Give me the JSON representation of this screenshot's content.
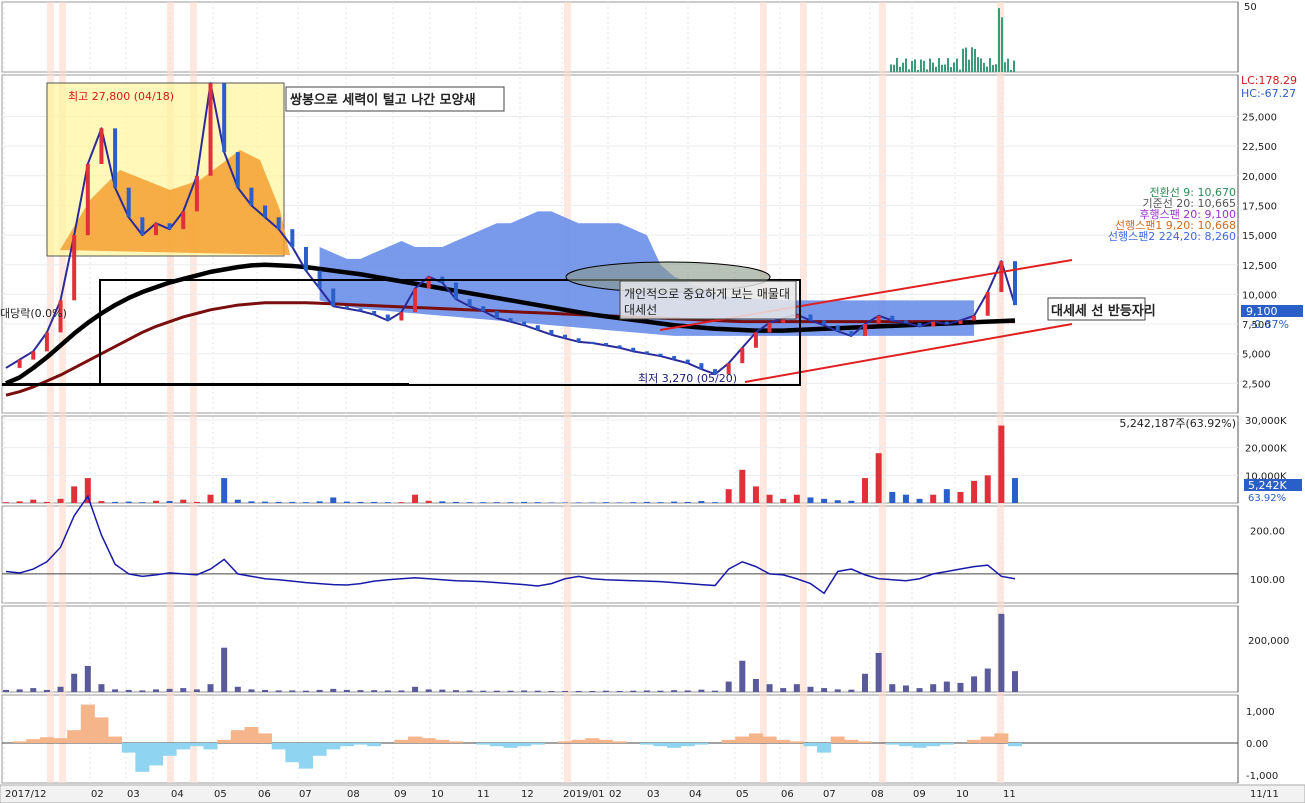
{
  "chart_data": {
    "type": "line",
    "title": "",
    "x_month_labels": [
      "2017/12",
      "02",
      "03",
      "04",
      "05",
      "06",
      "07",
      "08",
      "09",
      "10",
      "11",
      "12",
      "2019/01",
      "02",
      "03",
      "04",
      "05",
      "06",
      "07",
      "08",
      "09",
      "10",
      "11"
    ],
    "x_end_label": "11/11",
    "price_axis_ticks": [
      "25,000",
      "22,500",
      "20,000",
      "17,500",
      "15,000",
      "12,500",
      "10,000",
      "7,500",
      "5,000",
      "2,500"
    ],
    "price_ylim": [
      0,
      28500
    ],
    "price_close": [
      3800,
      4500,
      5200,
      6800,
      9500,
      15000,
      21000,
      24000,
      19000,
      16500,
      15000,
      16000,
      15500,
      17000,
      20000,
      27800,
      22000,
      19000,
      17500,
      16500,
      15500,
      14000,
      12000,
      10500,
      9000,
      8800,
      8600,
      8300,
      7800,
      8500,
      10500,
      11500,
      11000,
      9600,
      9000,
      8600,
      8000,
      7700,
      7400,
      7000,
      6600,
      6300,
      6000,
      5900,
      5700,
      5500,
      5200,
      5000,
      4800,
      4500,
      4200,
      3700,
      3270,
      4200,
      5500,
      6800,
      7600,
      8000,
      8300,
      7800,
      7400,
      6900,
      6500,
      7500,
      8200,
      7800,
      7600,
      7300,
      7700,
      7500,
      7800,
      8200,
      10200,
      12800,
      9100
    ],
    "ma_long": [
      2500,
      3000,
      3800,
      4700,
      5700,
      6700,
      7600,
      8400,
      9100,
      9700,
      10200,
      10600,
      11000,
      11300,
      11600,
      11900,
      12100,
      12300,
      12450,
      12500,
      12450,
      12400,
      12300,
      12150,
      12000,
      11850,
      11700,
      11500,
      11300,
      11100,
      10900,
      10700,
      10500,
      10300,
      10100,
      9900,
      9700,
      9500,
      9300,
      9100,
      8900,
      8700,
      8500,
      8300,
      8150,
      8000,
      7850,
      7700,
      7550,
      7400,
      7300,
      7200,
      7100,
      7050,
      7000,
      6950,
      6950,
      6950,
      7000,
      7050,
      7100,
      7150,
      7200,
      7250,
      7300,
      7350,
      7400,
      7450,
      7500,
      7550,
      7600,
      7650,
      7700,
      7750,
      7800
    ],
    "ma_200": [
      1500,
      1800,
      2200,
      2700,
      3200,
      3800,
      4400,
      5000,
      5600,
      6200,
      6800,
      7300,
      7700,
      8100,
      8400,
      8700,
      8900,
      9100,
      9200,
      9300,
      9300,
      9300,
      9300,
      9250,
      9200,
      9150,
      9100,
      9050,
      9000,
      8950,
      8900,
      8850,
      8800,
      8750,
      8700,
      8650,
      8600,
      8550,
      8500,
      8450,
      8400,
      8350,
      8300,
      8250,
      8200,
      8150,
      8100,
      8050,
      8000,
      7950,
      7900,
      7850,
      7800,
      7750,
      7700,
      7700,
      7700,
      7700,
      7700,
      7700,
      7700,
      7700,
      7700,
      7700,
      7700,
      7700,
      7700,
      7700,
      7700,
      7700,
      7700,
      7700,
      7700,
      7700,
      7700
    ],
    "cloud_top": [
      0,
      0,
      0,
      0,
      0,
      0,
      0,
      0,
      0,
      0,
      0,
      0,
      0,
      0,
      0,
      0,
      0,
      0,
      0,
      0,
      0,
      0,
      0,
      14000,
      13500,
      13000,
      13000,
      13500,
      14000,
      14500,
      14000,
      14000,
      14000,
      14500,
      15000,
      15500,
      16000,
      16000,
      16500,
      17000,
      17000,
      16500,
      16000,
      16000,
      16000,
      16000,
      15500,
      15000,
      12500,
      11500,
      11000,
      10500,
      10000,
      9800,
      9700,
      9600,
      9600,
      9500,
      9500,
      9500,
      9500,
      9500,
      9500,
      9500,
      9500,
      9500,
      9500,
      9500,
      9500,
      9500,
      9500,
      9500,
      0,
      0,
      0
    ],
    "cloud_bottom": [
      0,
      0,
      0,
      0,
      0,
      0,
      0,
      0,
      0,
      0,
      0,
      0,
      0,
      0,
      0,
      0,
      0,
      0,
      0,
      0,
      0,
      0,
      0,
      9500,
      9200,
      9000,
      8800,
      8700,
      8600,
      8500,
      8400,
      8300,
      8200,
      8100,
      8000,
      7900,
      7800,
      7700,
      7600,
      7500,
      7400,
      7300,
      7200,
      7100,
      7000,
      6900,
      6800,
      6700,
      6600,
      6500,
      6500,
      6500,
      6500,
      6500,
      6500,
      6500,
      6500,
      6500,
      6500,
      6500,
      6500,
      6500,
      6500,
      6500,
      6500,
      6500,
      6500,
      6500,
      6500,
      6500,
      6500,
      6500,
      0,
      0,
      0
    ],
    "volume_axis_ticks": [
      "30,000K",
      "20,000K",
      "10,000K"
    ],
    "volume_ylim": [
      0,
      30000
    ],
    "volume": [
      300,
      600,
      1200,
      400,
      1500,
      6000,
      9000,
      700,
      400,
      500,
      300,
      800,
      700,
      1200,
      400,
      3000,
      9000,
      1200,
      600,
      500,
      400,
      400,
      300,
      600,
      2000,
      500,
      400,
      400,
      300,
      300,
      3000,
      800,
      600,
      400,
      300,
      300,
      300,
      300,
      400,
      300,
      200,
      200,
      200,
      200,
      300,
      200,
      300,
      400,
      300,
      500,
      400,
      700,
      300,
      5000,
      12000,
      6000,
      3000,
      1500,
      3000,
      2000,
      1500,
      1000,
      800,
      9000,
      18000,
      4000,
      3000,
      1500,
      3000,
      5000,
      4000,
      8000,
      10000,
      28000,
      9000
    ],
    "volume_last_label": "5,242K",
    "volume_last_pct": "63.92%",
    "volume_header": "5,242,187주(63.92%)",
    "ind1_axis_ticks": [
      "200.00",
      "100.00"
    ],
    "ind1_ylim": [
      50,
      250
    ],
    "ind1": [
      115,
      112,
      120,
      135,
      165,
      230,
      270,
      190,
      130,
      110,
      105,
      108,
      112,
      110,
      108,
      120,
      140,
      110,
      105,
      100,
      98,
      95,
      92,
      90,
      88,
      87,
      90,
      95,
      98,
      100,
      102,
      100,
      98,
      96,
      95,
      94,
      92,
      90,
      88,
      85,
      90,
      100,
      105,
      100,
      98,
      97,
      96,
      95,
      94,
      92,
      90,
      88,
      86,
      120,
      135,
      125,
      110,
      108,
      100,
      90,
      70,
      115,
      120,
      108,
      100,
      98,
      96,
      100,
      110,
      115,
      120,
      125,
      128,
      105,
      100
    ],
    "ind1_baseline": 110,
    "ind2_axis_ticks": [
      "200,000"
    ],
    "ind2_ylim": [
      0,
      330000
    ],
    "ind2": [
      8000,
      10000,
      15000,
      8000,
      20000,
      70000,
      100000,
      30000,
      10000,
      8000,
      6000,
      10000,
      12000,
      15000,
      10000,
      30000,
      170000,
      20000,
      10000,
      8000,
      6000,
      6000,
      5000,
      8000,
      12000,
      8000,
      7000,
      7000,
      6000,
      6000,
      20000,
      10000,
      9000,
      7000,
      6000,
      5000,
      5000,
      5000,
      6000,
      5000,
      4000,
      4000,
      4000,
      4000,
      5000,
      4000,
      5000,
      6000,
      5000,
      7000,
      6000,
      9000,
      5000,
      40000,
      120000,
      50000,
      30000,
      15000,
      30000,
      20000,
      15000,
      10000,
      9000,
      70000,
      150000,
      30000,
      25000,
      15000,
      30000,
      40000,
      35000,
      60000,
      90000,
      300000,
      80000
    ],
    "ind3_axis_ticks": [
      "1,000",
      "0.00",
      "-1,000"
    ],
    "ind3_ylim": [
      -1250,
      1500
    ],
    "ind3": [
      0,
      50,
      120,
      180,
      150,
      400,
      1200,
      800,
      200,
      -300,
      -900,
      -700,
      -400,
      -200,
      -100,
      -200,
      100,
      400,
      500,
      300,
      -200,
      -600,
      -800,
      -400,
      -200,
      -100,
      -50,
      -100,
      0,
      100,
      200,
      150,
      100,
      50,
      0,
      -50,
      -100,
      -150,
      -100,
      -50,
      0,
      50,
      100,
      150,
      100,
      50,
      0,
      -50,
      -100,
      -150,
      -100,
      -50,
      0,
      100,
      200,
      300,
      200,
      100,
      50,
      -100,
      -300,
      200,
      100,
      50,
      0,
      -50,
      -100,
      -150,
      -100,
      -50,
      0,
      100,
      200,
      300,
      -100
    ],
    "ind3_top_axis_tick": "50",
    "legend": [
      {
        "label": "전환선 9: 10,670",
        "color": "#2e8b57"
      },
      {
        "label": "기준선 20: 10,665",
        "color": "#555555"
      },
      {
        "label": "후행스팬 20: 9,100",
        "color": "#9932cc"
      },
      {
        "label": "선행스팬1 9,20: 10,668",
        "color": "#d2691e"
      },
      {
        "label": "선행스팬2 224,20: 8,260",
        "color": "#4169e1"
      }
    ],
    "lc_label": "LC:178.29",
    "hc_label": "HC:-67.27",
    "last_price_label": "9,100",
    "last_change_label": "-0.87%",
    "annotations": {
      "high": "최고 27,800 (04/18)",
      "low": "최저 3,270 (05/20)",
      "note_box": "쌍봉으로 세력이 털고 나간 모양새",
      "note_neck": "개인적으로 중요하게 보는 매물대",
      "note_neck_line2": "대세선",
      "note_bounce": "대세세 선 반등자리",
      "left_label": "대당락(0.0%)"
    }
  }
}
